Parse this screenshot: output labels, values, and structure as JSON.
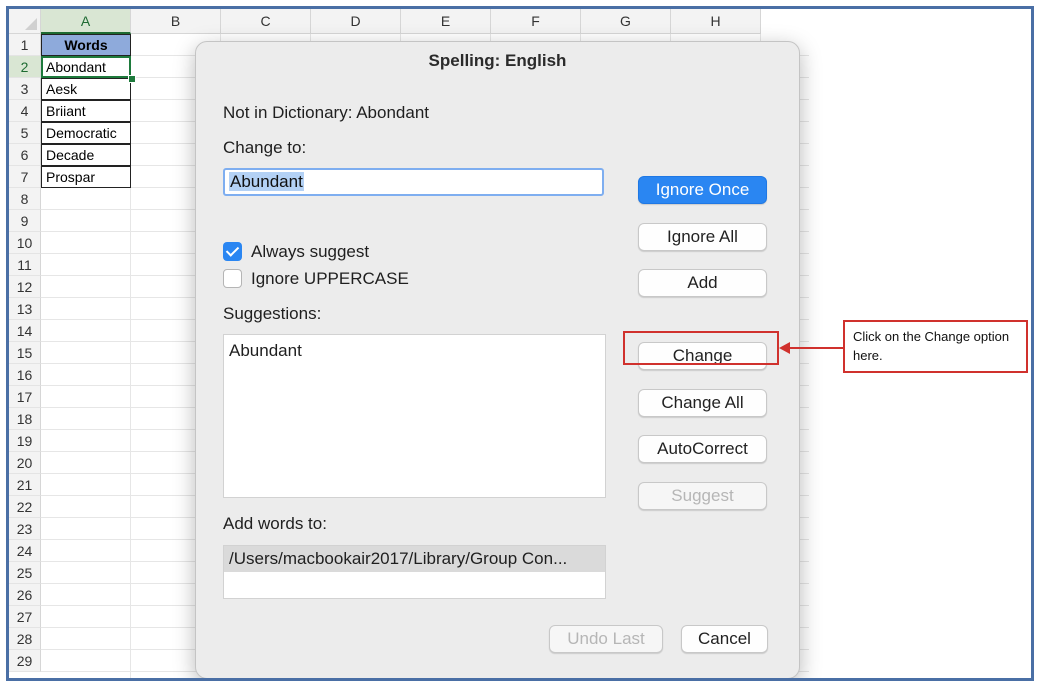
{
  "spreadsheet": {
    "columns": [
      "A",
      "B",
      "C",
      "D",
      "E",
      "F",
      "G",
      "H"
    ],
    "rows": [
      "1",
      "2",
      "3",
      "4",
      "5",
      "6",
      "7",
      "8",
      "9",
      "10",
      "11",
      "12",
      "13",
      "14",
      "15",
      "16",
      "17",
      "18",
      "19",
      "20",
      "21",
      "22",
      "23",
      "24",
      "25",
      "26",
      "27",
      "28",
      "29"
    ],
    "cells": [
      "Words",
      "Abondant",
      "Aesk",
      "Briiant",
      "Democratic",
      "Decade",
      "Prospar"
    ],
    "selected_column": "A",
    "selected_row": "2",
    "header_fill": "#8eaadb"
  },
  "dialog": {
    "title": "Spelling: English",
    "not_in_dictionary": "Not in Dictionary: Abondant",
    "change_to_label": "Change to:",
    "change_to_value": "Abundant",
    "always_suggest_label": "Always suggest",
    "always_suggest_checked": true,
    "ignore_uppercase_label": "Ignore UPPERCASE",
    "ignore_uppercase_checked": false,
    "suggestions_label": "Suggestions:",
    "suggestions": [
      "Abundant"
    ],
    "add_words_label": "Add words to:",
    "add_words_value": "/Users/macbookair2017/Library/Group Con...",
    "buttons": {
      "ignore_once": "Ignore Once",
      "ignore_all": "Ignore All",
      "add": "Add",
      "change": "Change",
      "change_all": "Change All",
      "autocorrect": "AutoCorrect",
      "suggest": "Suggest",
      "undo_last": "Undo Last",
      "cancel": "Cancel"
    },
    "accent_color": "#2a86f2"
  },
  "annotation": {
    "text": "Click on the Change option here.",
    "color": "#d0312d"
  }
}
